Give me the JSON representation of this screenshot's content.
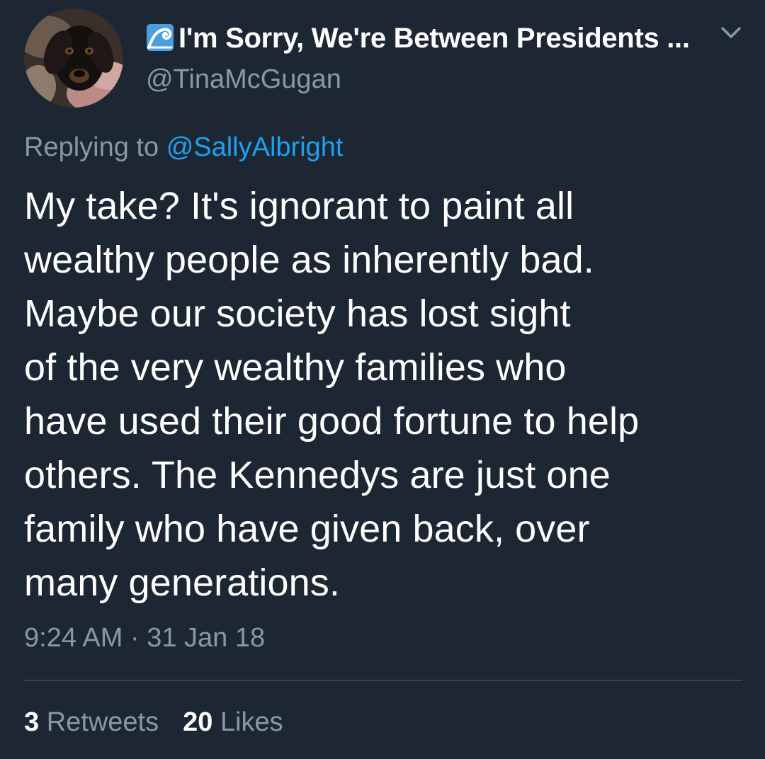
{
  "author": {
    "display_name": "I'm Sorry, We're Between Presidents ...",
    "handle": "@TinaMcGugan",
    "name_emoji_icon": "water-wave-icon",
    "avatar_icon": "dog-photo-avatar"
  },
  "menu_icon": "chevron-down-icon",
  "reply": {
    "prefix": "Replying to",
    "mention": "@SallyAlbright"
  },
  "tweet": {
    "lines": [
      "My take? It's ignorant to paint all",
      "wealthy people as inherently bad.",
      "Maybe our society has lost sight",
      "of the very wealthy families who",
      "have used their good fortune to help",
      "others. The Kennedys are just one",
      "family who have given back, over",
      "many generations."
    ],
    "timestamp": "9:24 AM · 31 Jan 18"
  },
  "stats": {
    "retweets_count": "3",
    "retweets_label": "Retweets",
    "likes_count": "20",
    "likes_label": "Likes"
  },
  "colors": {
    "background": "#1c2733",
    "text_primary": "#ffffff",
    "text_secondary": "#8899a6",
    "link": "#1da1f2",
    "divider": "#38444d"
  }
}
